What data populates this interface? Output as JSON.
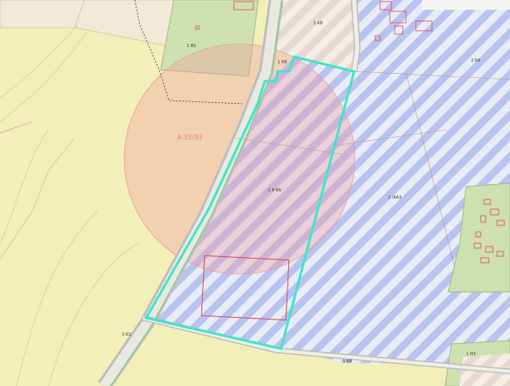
{
  "map": {
    "colors": {
      "base": "#f3efb8",
      "stripe_blue": "#b8c4ef",
      "stripe_light": "#e9ecf7",
      "pink_circle": "#f29aa0",
      "highlight": "#3ee6c8",
      "road": "#b9b9b9",
      "building_outline": "#d8474f",
      "green_plot": "#cfe0b0"
    },
    "labels": {
      "zone_label": "A-35/93",
      "parcel_main": "1 8 KA",
      "parcel_east": "2 /KA3",
      "parcel_top": "1 KB",
      "parcel_topleft": "1 BS",
      "parcel_road": "1 KB",
      "parcel_bottom_right": "1 H3",
      "road_label": "1 KB",
      "parcel_far_right": "2 KA",
      "parcel_small": "3 K3"
    }
  }
}
